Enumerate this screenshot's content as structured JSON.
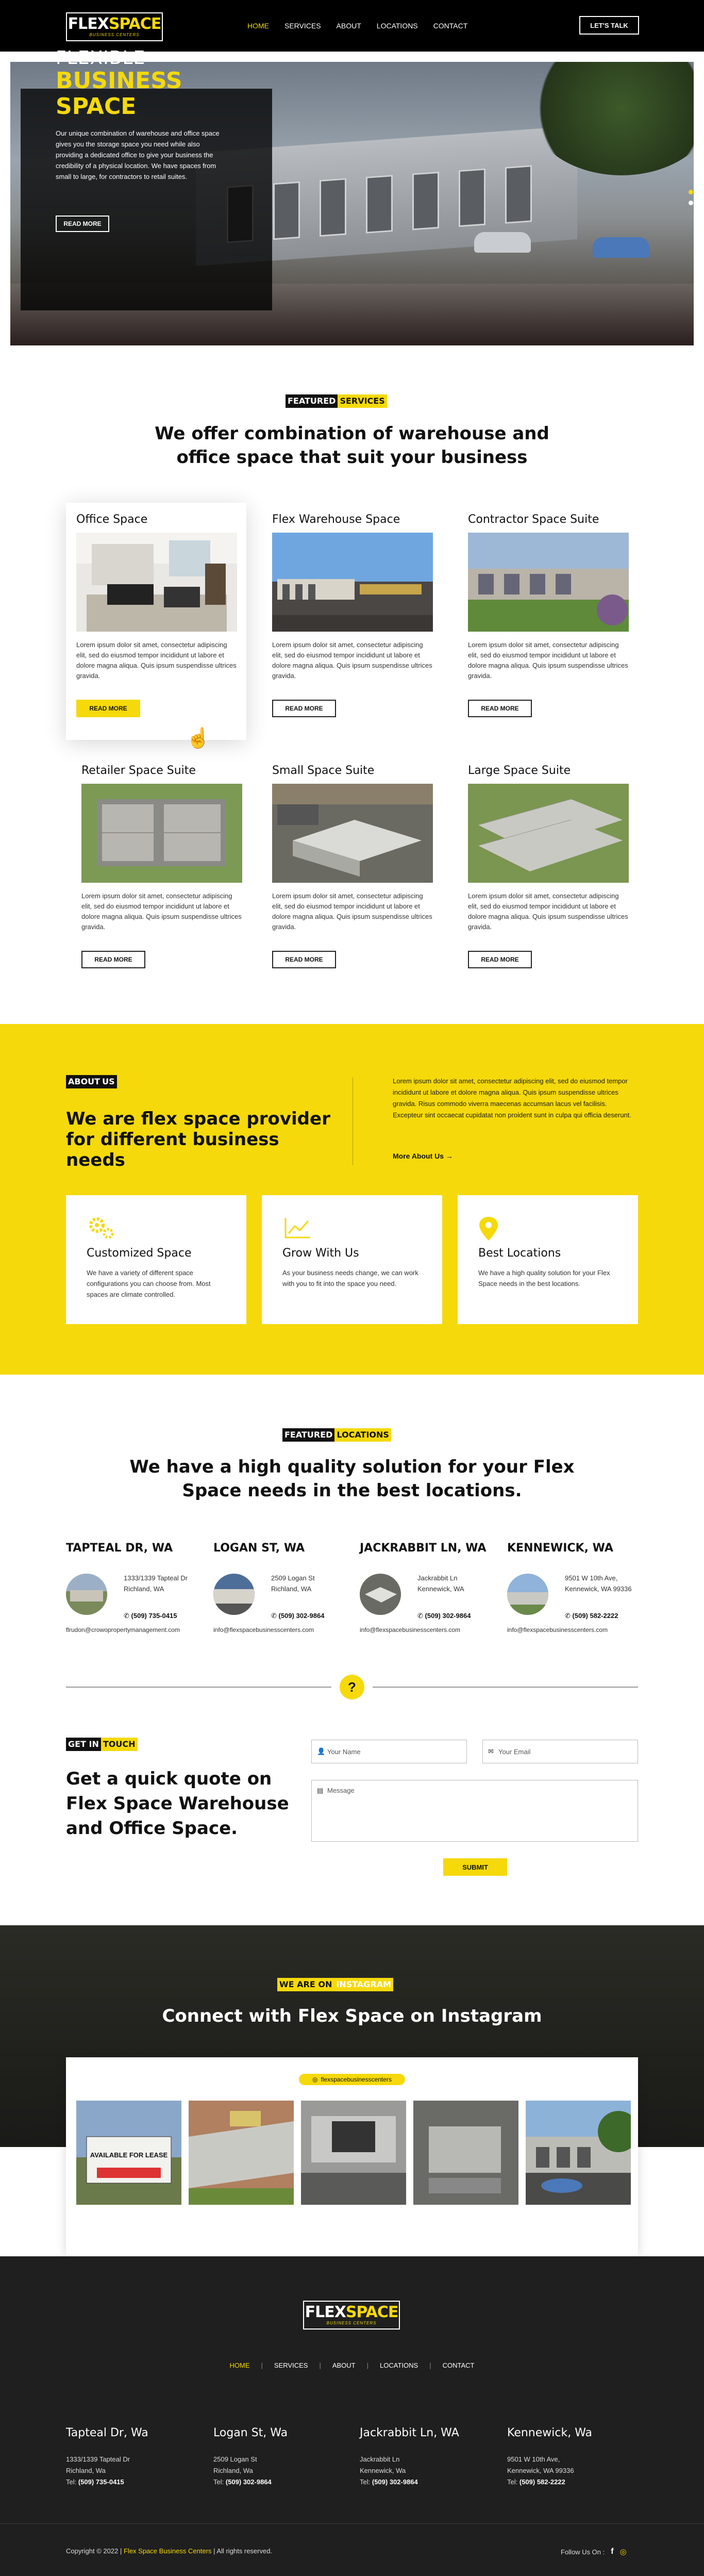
{
  "brand": {
    "name_1": "FLEX",
    "name_2": "SPACE",
    "tagline": "BUSINESS CENTERS"
  },
  "header": {
    "nav": [
      "HOME",
      "SERVICES",
      "ABOUT",
      "LOCATIONS",
      "CONTACT"
    ],
    "active": "HOME",
    "cta": "LET'S TALK"
  },
  "hero": {
    "line1": "FLEXIBLE",
    "line2": "BUSINESS",
    "line3": "SPACE",
    "text": "Our unique combination of warehouse and office space gives you the storage space you need while also providing a dedicated office to give your business the credibility of a physical location. We have spaces from small to large, for contractors to retail suites.",
    "button": "READ MORE",
    "slides": 2
  },
  "services": {
    "tag_a": "FEATURED",
    "tag_b": "SERVICES",
    "heading_1": "We offer combination of warehouse and",
    "heading_2": "office space that suit your business",
    "lorem": "Lorem ipsum dolor sit amet, consectetur adipiscing elit, sed do eiusmod tempor incididunt ut labore et dolore magna aliqua. Quis ipsum suspendisse ultrices gravida.",
    "button": "READ MORE",
    "items": [
      {
        "title": "Office Space"
      },
      {
        "title": "Flex Warehouse Space"
      },
      {
        "title": "Contractor Space Suite"
      },
      {
        "title": "Retailer Space Suite"
      },
      {
        "title": "Small Space Suite"
      },
      {
        "title": "Large Space Suite"
      }
    ]
  },
  "about": {
    "tag_a": "ABOUT",
    "tag_b": "US",
    "heading": "We are flex space provider for different business needs",
    "paragraph": "Lorem ipsum dolor sit amet, consectetur adipiscing elit, sed do eiusmod tempor incididunt ut labore et dolore magna aliqua. Quis ipsum suspendisse ultrices gravida. Risus commodo viverra maecenas accumsan lacus vel facilisis. Excepteur sint occaecat cupidatat non proident sunt in culpa qui officia deserunt.",
    "more": "More About Us →",
    "features": [
      {
        "icon": "gears-icon",
        "title": "Customized Space",
        "text": "We have a variety of different space configurations you can choose from. Most spaces are climate controlled."
      },
      {
        "icon": "growth-chart-icon",
        "title": "Grow With Us",
        "text": "As your business needs change, we can work with you to fit into the space you need."
      },
      {
        "icon": "map-pin-icon",
        "title": "Best Locations",
        "text": "We have a high quality solution for your Flex Space needs in the best locations."
      }
    ]
  },
  "locations": {
    "tag_a": "FEATURED",
    "tag_b": "LOCATIONS",
    "heading_1": "We have a high quality solution for your Flex",
    "heading_2": "Space needs in the best locations.",
    "phone_label": "Tel:",
    "items": [
      {
        "title": "TAPTEAL DR, WA",
        "addr1": "1333/1339 Tapteal Dr",
        "addr2": "Richland, WA",
        "addr3": "",
        "phone": "(509) 735-0415",
        "email": "flrudon@crowopropertymanagement.com"
      },
      {
        "title": "LOGAN ST, WA",
        "addr1": "2509 Logan St",
        "addr2": "Richland, WA",
        "addr3": "",
        "phone": "(509) 302-9864",
        "email": "info@flexspacebusinesscenters.com"
      },
      {
        "title": "JACKRABBIT LN, WA",
        "addr1": "Jackrabbit Ln",
        "addr2": "Kennewick, WA",
        "addr3": "",
        "phone": "(509) 302-9864",
        "email": "info@flexspacebusinesscenters.com"
      },
      {
        "title": "KENNEWICK, WA",
        "addr1": "9501 W 10th Ave,",
        "addr2": "Kennewick, WA 99336",
        "addr3": "",
        "phone": "(509) 582-2222",
        "email": "info@flexspacebusinesscenters.com"
      }
    ],
    "badge": "?"
  },
  "touch": {
    "tag_a": "GET IN",
    "tag_b": "TOUCH",
    "heading": "Get a quick quote on Flex Space Warehouse and Office Space.",
    "name_placeholder": "Your Name",
    "email_placeholder": "Your Email",
    "message_placeholder": "Message",
    "submit": "SUBMIT"
  },
  "instagram": {
    "tag_a": "WE ARE ON",
    "tag_b": "INSTAGRAM",
    "heading": "Connect with Flex Space on Instagram",
    "handle": "flexspacebusinesscenters",
    "sign_text": "AVAILABLE FOR LEASE"
  },
  "footer": {
    "nav": [
      "HOME",
      "SERVICES",
      "ABOUT",
      "LOCATIONS",
      "CONTACT"
    ],
    "separator": "|",
    "cols": [
      {
        "title": "Tapteal Dr, Wa",
        "addr1": "1333/1339 Tapteal Dr",
        "addr2": "Richland, Wa",
        "phone": "(509) 735-0415"
      },
      {
        "title": "Logan St, Wa",
        "addr1": "2509 Logan St",
        "addr2": "Richland, Wa",
        "phone": "(509) 302-9864"
      },
      {
        "title": "Jackrabbit Ln, WA",
        "addr1": "Jackrabbit Ln",
        "addr2": "Kennewick, Wa",
        "phone": "(509) 302-9864"
      },
      {
        "title": "Kennewick, Wa",
        "addr1": "9501 W 10th Ave,",
        "addr2": "Kennewick, WA 99336",
        "phone": "(509) 582-2222"
      }
    ],
    "copy_1": "Copyright © 2022 |",
    "copy_2": "Flex Space Business Centers",
    "copy_3": "| All rights reserved.",
    "follow": "Follow Us On :",
    "facebook": "f"
  },
  "colors": {
    "accent": "#f5d90a",
    "dark": "#000000",
    "footer": "#1f1f1f"
  }
}
